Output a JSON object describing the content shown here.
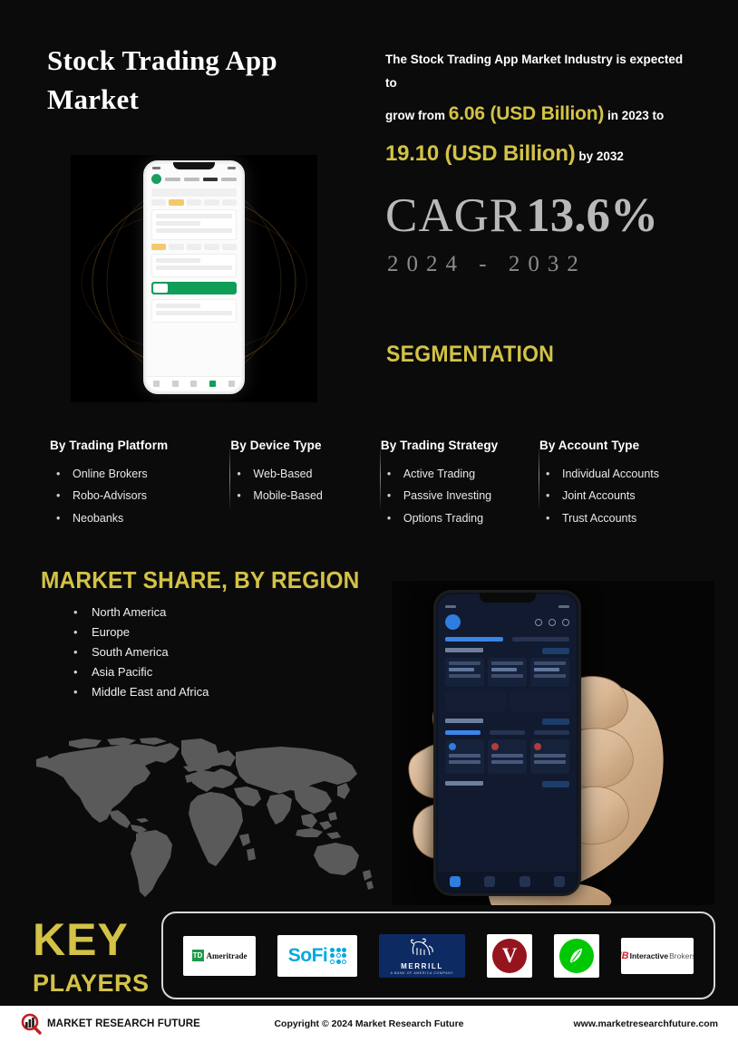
{
  "title": "Stock Trading App Market",
  "stat": {
    "line1": "The Stock Trading App Market Industry is expected to",
    "grow_from": "grow from",
    "value_2023": "6.06 (USD Billion)",
    "mid": "in 2023 to",
    "value_2032": "19.10 (USD Billion)",
    "tail": "by 2032"
  },
  "cagr": {
    "label": "CAGR",
    "value": "13.6%",
    "years": "2024 - 2032"
  },
  "segmentation": {
    "heading": "SEGMENTATION",
    "bullet": "•",
    "columns": [
      {
        "title": "By Trading Platform",
        "items": [
          "Online Brokers",
          "Robo-Advisors",
          "Neobanks"
        ]
      },
      {
        "title": "By Device Type",
        "items": [
          "Web-Based",
          "Mobile-Based"
        ]
      },
      {
        "title": "By Trading Strategy",
        "items": [
          "Active Trading",
          "Passive Investing",
          "Options Trading"
        ]
      },
      {
        "title": "By Account Type",
        "items": [
          "Individual Accounts",
          "Joint Accounts",
          "Trust Accounts"
        ]
      }
    ]
  },
  "region": {
    "heading": "MARKET SHARE, BY REGION",
    "bullet": "•",
    "items": [
      "North America",
      "Europe",
      "South America",
      "Asia Pacific",
      "Middle East and Africa"
    ]
  },
  "key_players": {
    "line1": "KEY",
    "line2": "PLAYERS",
    "logos": [
      {
        "name": "td-ameritrade",
        "mark": "TD",
        "text": "Ameritrade"
      },
      {
        "name": "sofi",
        "text": "SoFi"
      },
      {
        "name": "merrill",
        "text": "MERRILL",
        "sub": "A BANK OF AMERICA COMPANY"
      },
      {
        "name": "vanguard",
        "text": "V"
      },
      {
        "name": "robinhood",
        "text": ""
      },
      {
        "name": "interactive-brokers",
        "mark": "IB",
        "text_bold": "Interactive",
        "text_light": "Brokers"
      }
    ]
  },
  "footer": {
    "brand": "MARKET RESEARCH FUTURE",
    "copyright": "Copyright © 2024 Market Research Future",
    "url": "www.marketresearchfuture.com"
  },
  "colors": {
    "background": "#0b0b0b",
    "gold": "#d3c246",
    "text": "#ffffff",
    "cagr_gray": "#b9b9b9",
    "map_gray": "#5a5a5a"
  }
}
